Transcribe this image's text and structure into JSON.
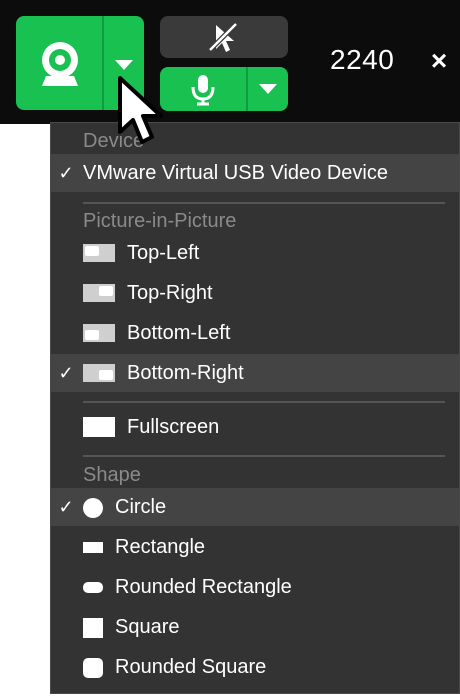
{
  "toolbar": {
    "dimension": "2240",
    "close_label": "×"
  },
  "menu": {
    "device_header": "Device",
    "device_items": [
      {
        "label": "VMware Virtual USB Video Device",
        "checked": true
      }
    ],
    "pip_header": "Picture-in-Picture",
    "pip_items": [
      {
        "label": "Top-Left",
        "checked": false
      },
      {
        "label": "Top-Right",
        "checked": false
      },
      {
        "label": "Bottom-Left",
        "checked": false
      },
      {
        "label": "Bottom-Right",
        "checked": true
      },
      {
        "label": "Fullscreen",
        "checked": false
      }
    ],
    "shape_header": "Shape",
    "shape_items": [
      {
        "label": "Circle",
        "checked": true
      },
      {
        "label": "Rectangle",
        "checked": false
      },
      {
        "label": "Rounded Rectangle",
        "checked": false
      },
      {
        "label": "Square",
        "checked": false
      },
      {
        "label": "Rounded Square",
        "checked": false
      }
    ],
    "check_mark": "✓"
  },
  "colors": {
    "accent_green": "#19c150",
    "menu_bg": "#333333",
    "selected_bg": "#444444",
    "header_text": "#8a8a8a"
  },
  "icons": {
    "camera": "webcam-icon",
    "cursor_off": "cursor-off-icon",
    "mic": "microphone-icon",
    "dropdown": "chevron-down-icon",
    "close": "close-icon"
  }
}
